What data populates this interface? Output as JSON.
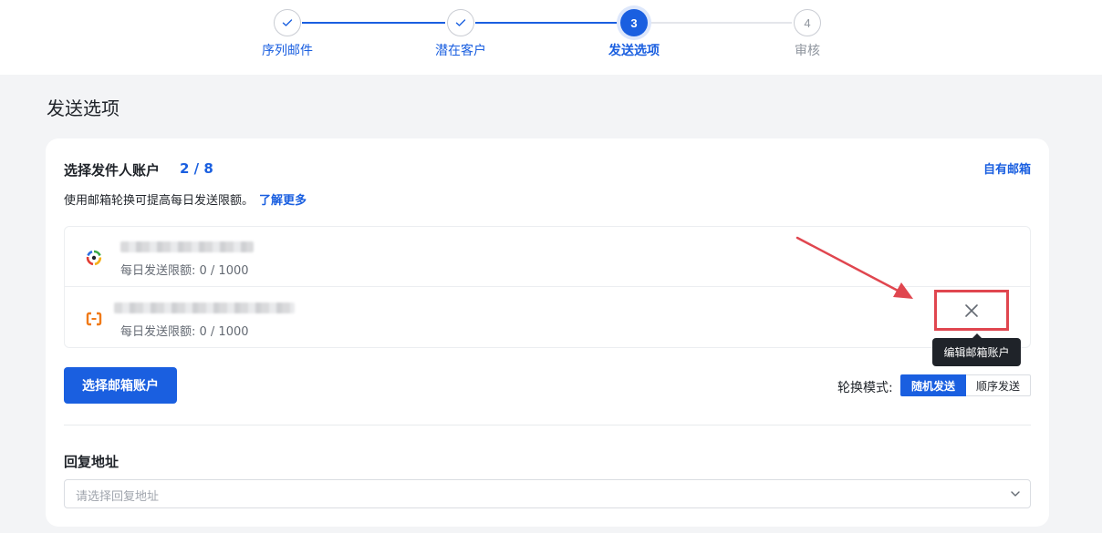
{
  "stepper": {
    "steps": [
      {
        "label": "序列邮件",
        "number": "1",
        "state": "done"
      },
      {
        "label": "潜在客户",
        "number": "2",
        "state": "done"
      },
      {
        "label": "发送选项",
        "number": "3",
        "state": "active"
      },
      {
        "label": "审核",
        "number": "4",
        "state": "todo"
      }
    ]
  },
  "page": {
    "title": "发送选项"
  },
  "sender": {
    "title": "选择发件人账户",
    "count": "2 / 8",
    "own_mailbox_link": "自有邮箱",
    "hint": "使用邮箱轮换可提高每日发送限额。",
    "learn_more": "了解更多",
    "accounts": [
      {
        "provider_icon": "netease-mail-icon",
        "limit_text": "每日发送限额: 0 / 1000"
      },
      {
        "provider_icon": "aliyun-mail-icon",
        "limit_text": "每日发送限额: 0 / 1000"
      }
    ],
    "edit_tooltip": "编辑邮箱账户",
    "select_button": "选择邮箱账户",
    "rotation": {
      "label": "轮换模式:",
      "options": [
        "随机发送",
        "顺序发送"
      ],
      "selected": "随机发送"
    }
  },
  "reply": {
    "title": "回复地址",
    "placeholder": "请选择回复地址"
  },
  "colors": {
    "accent": "#1a5fe0",
    "highlight_box": "#e0464f",
    "tooltip_bg": "#1f2329"
  }
}
